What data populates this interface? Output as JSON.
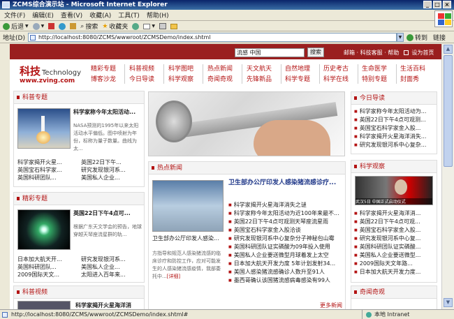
{
  "browser": {
    "title": "ZCMS综合演示站 - Microsoft Internet Explorer",
    "menu": [
      "文件(F)",
      "编辑(E)",
      "查看(V)",
      "收藏(A)",
      "工具(T)",
      "帮助(H)"
    ],
    "toolbar": {
      "back": "后退",
      "search": "搜索",
      "favorites": "收藏夹"
    },
    "address_label": "地址(D)",
    "address": "http://localhost:8080/ZCMS/wwwroot/ZCMSDemo/index.shtml",
    "go": "转到",
    "links": "链接",
    "status_url": "http://localhost:8080/ZCMS/wwwroot/ZCMSDemo/index.shtml#",
    "status_zone": "本地 Intranet"
  },
  "site": {
    "search_value": "流感 中国",
    "search_btn": "搜索",
    "toplinks": "邮箱 · 科技客服 · 帮助",
    "set_home": "设为首页",
    "logo_cn": "科技",
    "logo_en": "Technology",
    "logo_url": "www.zving.com",
    "nav": [
      [
        "精彩专题",
        "博客沙龙"
      ],
      [
        "科普视频",
        "今日导读"
      ],
      [
        "科学图吧",
        "科学观察"
      ],
      [
        "热点新闻",
        "奇闻奇观"
      ],
      [
        "天文航天",
        "先锋新品"
      ],
      [
        "自然地理",
        "科学专题"
      ],
      [
        "历史考古",
        "科学在线"
      ],
      [
        "生命医学",
        "特别专题"
      ],
      [
        "生活百科",
        "封面秀"
      ]
    ],
    "kepu": {
      "title": "科普专题",
      "headline": "科学家称今年太阳活动...",
      "desc": "NASA预测的1995年以来太阳活动水平偏低。图中喷射为年份，标称为量子数量。曲线为太...",
      "links": [
        "科学家揭开火星...",
        "英国宝石科学家...",
        "英国科研团队..."
      ],
      "links2": [
        "英国22日下午...",
        "研究发现银河系...",
        "美国私人企业..."
      ]
    },
    "jingcai": {
      "title": "精彩专题",
      "headline": "英国22日下午4点可...",
      "desc": "根据广东天文学会的预告，地球穿越天琴座流星群的轨...",
      "links": [
        "日本加大航天开...",
        "英国科研团队...",
        "2009国际天文..."
      ],
      "links2": [
        "研究发现银河系...",
        "美国私人企业...",
        "太阳进入百年来..."
      ]
    },
    "video": {
      "title": "科普视频",
      "headline": "科学家揭开火星海洋消"
    },
    "hot": {
      "title": "热点新闻",
      "headline": "卫生部办公厅印发人感染猪流感诊疗...",
      "caption": "卫生部办公厅印发人感染...",
      "desc": "方指导和规范人感染猪流感的临床诊疗和防控工作，应对可能发生的人感染猪流感疫情，我部委托中...",
      "more_detail": "[详细]",
      "list": [
        "科学家揭开火星海洋消失之谜",
        "科学家称今年太阳活动为近100年来最不...",
        "英国22日下午4点可观测天琴座流星雨",
        "英国宝石科学家金入股洽谈",
        "研究发现银河系中心复杂分子神秘包山霉",
        "英国科研团队证实磷酸为09年投入使用",
        "美国私人企业要送微型月球着发上太空",
        "日本加大航天开发力度 5年计划发射34...",
        "美国人感染猪流感确诊人数升至91人",
        "墨西哥确认该国猪流感病毒感染有99人"
      ],
      "more": "更多新闻"
    },
    "daodu": {
      "title": "今日导读",
      "list": [
        "科学家称今年太阳活动为...",
        "英国22日下午4点可观测...",
        "英国宝石科学家金入股...",
        "科学家揭开火星海洋消失...",
        "研究发现银河系中心复杂..."
      ]
    },
    "guancha": {
      "title": "科学观察",
      "caption": "武汉5日 中国正式启动仪式",
      "list": [
        "科学家揭开火星海洋消...",
        "英国22日下午4点可观...",
        "英国宝石科学家金入股...",
        "研究发现银河系中心复...",
        "英国科研团队证实磷酸...",
        "美国私人企业要送微型...",
        "2009国际天文年路...",
        "日本加大航天开发力度..."
      ]
    },
    "qiwen": {
      "title": "奇闻奇观"
    }
  }
}
